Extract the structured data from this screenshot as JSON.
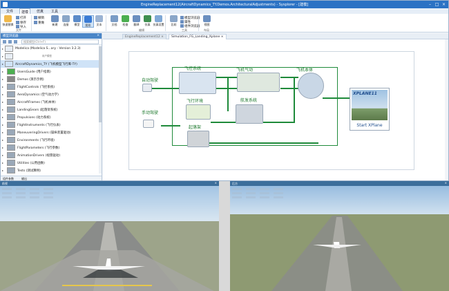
{
  "app": {
    "title": "EngineReplacement12(AircraftDynamics_TY.Demos.ArchitecturalAdjustments) - Sysplorer - [建模]",
    "menu": [
      "文件",
      "建模",
      "仿真",
      "工具"
    ],
    "menu_active": 1,
    "ribbon": {
      "big_buttons": [
        "快速替换",
        "新建",
        "连接",
        "模型",
        "图形",
        "文本",
        "文档",
        "检查",
        "翻译",
        "仿真",
        "仿真设置",
        "比较",
        "视图",
        "视图布局"
      ],
      "selected_button": 5,
      "small_items": [
        "打开",
        "保存",
        "导入",
        "撤销",
        "重做",
        "模型浏览器",
        "属性",
        "组件浏览器",
        "输出",
        "显示网格"
      ],
      "groups": [
        "文件",
        "编辑",
        "模型",
        "工具",
        "布局"
      ]
    }
  },
  "left_panel": {
    "title": "模型浏览器",
    "search_placeholder": "搜索模型(Ctrl+F)",
    "tree": [
      {
        "label": "Modelica (Modelica S...ary - Version 3.2.3)",
        "sub": "",
        "color": "#e8eef5"
      },
      {
        "label": "",
        "sub": "用户模型",
        "color": "#e8eef5"
      },
      {
        "label": "AircraftDynamics_TY (飞机模型飞行库-TY)",
        "sub": "",
        "color": "#cfe3f7"
      },
      {
        "label": "UsersGuide (用户指南)",
        "sub": "",
        "color": "#4caf50"
      },
      {
        "label": "Demos (演示示例)",
        "sub": "",
        "color": "#888888"
      },
      {
        "label": "FlightControls (飞控系统)",
        "sub": "",
        "color": "#9aa8b8"
      },
      {
        "label": "AeroDynamics (空气动力学)",
        "sub": "",
        "color": "#9aa8b8"
      },
      {
        "label": "AircraftFrames (飞机本体)",
        "sub": "",
        "color": "#9aa8b8"
      },
      {
        "label": "LandingGears (起落架系统)",
        "sub": "",
        "color": "#9aa8b8"
      },
      {
        "label": "Propulsions (动力系统)",
        "sub": "",
        "color": "#9aa8b8"
      },
      {
        "label": "FlightInstruments (飞行仪表)",
        "sub": "",
        "color": "#9aa8b8"
      },
      {
        "label": "ManeuveringDrivers (操纵装置驱动)",
        "sub": "",
        "color": "#9aa8b8"
      },
      {
        "label": "Environments (飞行环境)",
        "sub": "",
        "color": "#9aa8b8"
      },
      {
        "label": "FlightParameters (飞行参数)",
        "sub": "",
        "color": "#9aa8b8"
      },
      {
        "label": "AnimationDrivers (视景驱动)",
        "sub": "",
        "color": "#9aa8b8"
      },
      {
        "label": "Utilities (公用函数)",
        "sub": "",
        "color": "#9aa8b8"
      },
      {
        "label": "Tests (测试算例)",
        "sub": "",
        "color": "#9aa8b8"
      }
    ],
    "bottom_tabs": [
      "组件参数",
      "输出"
    ]
  },
  "editor": {
    "tabs": [
      "EngineReplacement12 ×",
      "Simulation_FG_Landing_Xplane ×"
    ],
    "active_tab": 1
  },
  "diagram": {
    "labels": {
      "auto_drive": "自动驾驶",
      "manual_drive": "手动驾驶",
      "flight_control": "飞控系统",
      "aero": "飞机气动",
      "aircraft_body": "飞机本体",
      "flight_env": "飞行环境",
      "avionics": "航发系统",
      "landing_gear": "起落架",
      "xplane_logo": "XPLANE11",
      "xplane_button": "Start   XPlane"
    }
  },
  "views": {
    "left_title": "前视",
    "right_title": "后方"
  },
  "colors": {
    "titlebar": "#2b72c4",
    "wire": "#1e8a3a",
    "selection": "#cfe3f7"
  }
}
